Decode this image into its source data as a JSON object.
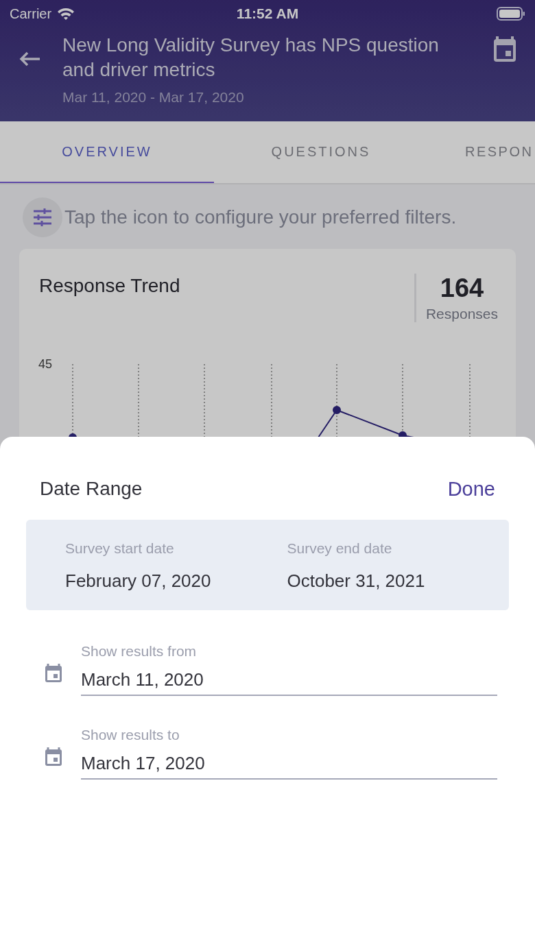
{
  "status_bar": {
    "carrier": "Carrier",
    "time": "11:52 AM"
  },
  "header": {
    "title": "New Long Validity Survey has NPS question and driver metrics",
    "date_range": "Mar 11, 2020 - Mar 17, 2020"
  },
  "tabs": [
    {
      "label": "OVERVIEW",
      "selected": true
    },
    {
      "label": "QUESTIONS",
      "selected": false
    },
    {
      "label": "RESPON",
      "selected": false
    }
  ],
  "filter_hint": "Tap the icon to configure your preferred filters.",
  "trend_card": {
    "title": "Response Trend",
    "count": "164",
    "count_label": "Responses",
    "axis_label": "45"
  },
  "sheet": {
    "title": "Date Range",
    "done": "Done",
    "survey_dates": [
      {
        "label": "Survey start date",
        "value": "February 07, 2020"
      },
      {
        "label": "Survey end date",
        "value": "October 31, 2021"
      }
    ],
    "fields": [
      {
        "label": "Show results from",
        "value": "March 11, 2020"
      },
      {
        "label": "Show results to",
        "value": "March 17, 2020"
      }
    ]
  }
}
